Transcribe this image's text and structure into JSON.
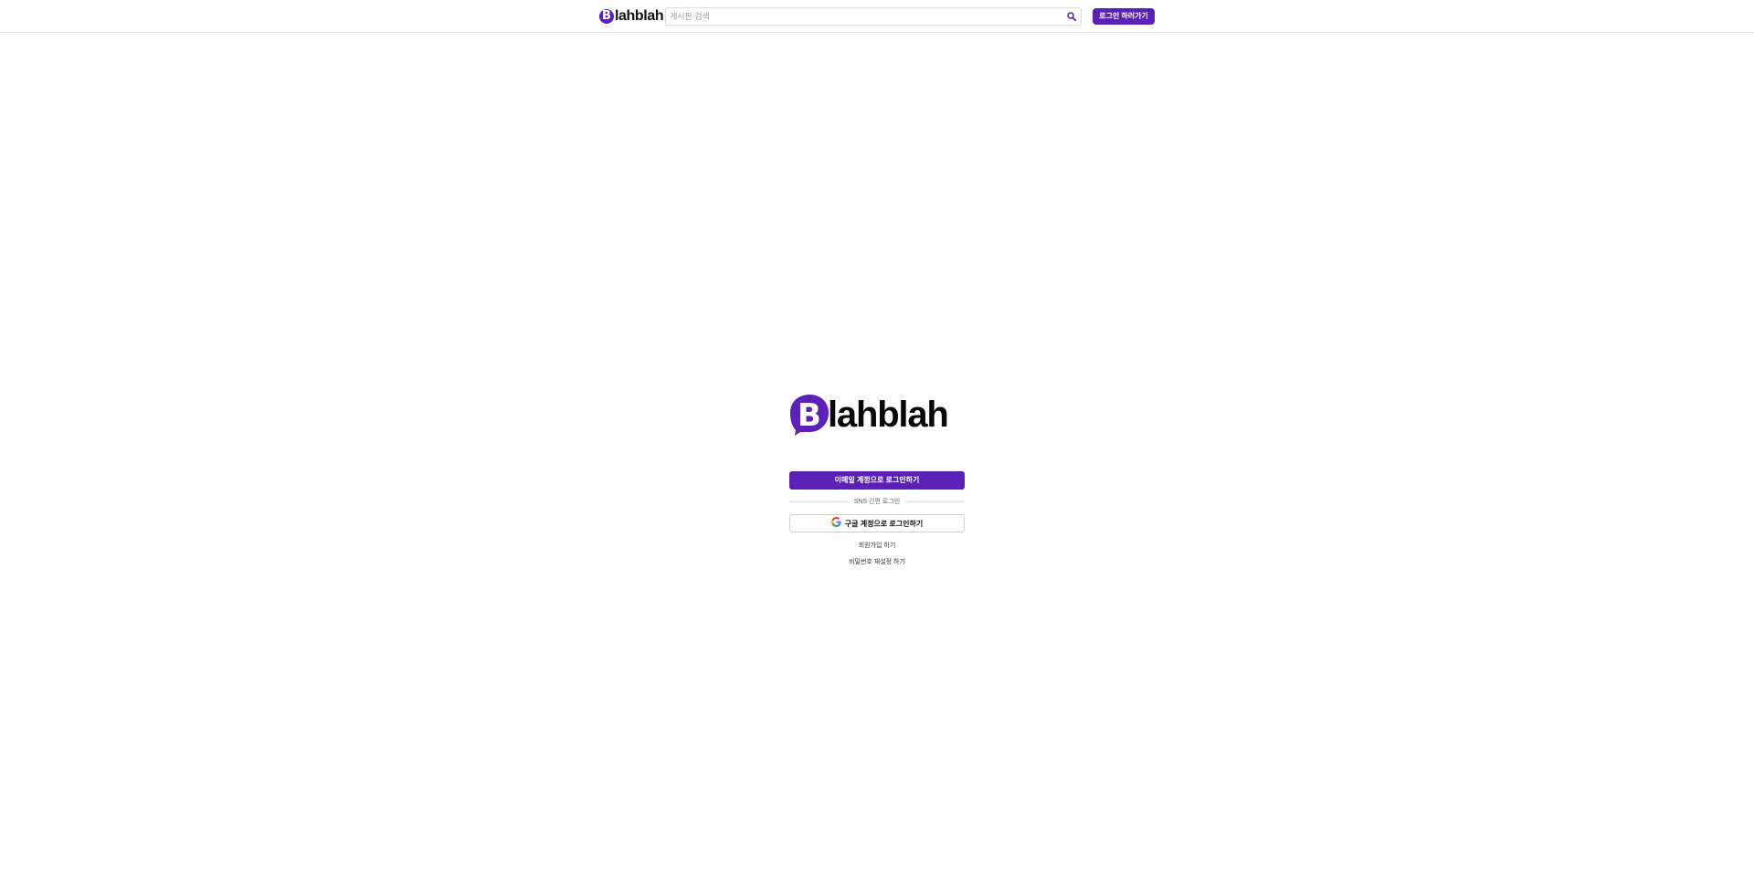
{
  "header": {
    "logo_text": "Blahblah",
    "search": {
      "placeholder": "게시판 검색",
      "value": "",
      "icon": "search-icon"
    },
    "login_button": "로그인 하러가기"
  },
  "main": {
    "logo_text": "Blahblah",
    "email_login_button": "이메일 계정으로 로그인하기",
    "divider_text": "SNS 간편 로그인",
    "google_login_button": "구글 계정으로 로그인하기",
    "signup_link": "회원가입 하기",
    "reset_password_link": "비밀번호 재설정 하기"
  },
  "colors": {
    "brand": "#5b21b6",
    "background": "#ffffff",
    "border": "#dcdcdc"
  }
}
